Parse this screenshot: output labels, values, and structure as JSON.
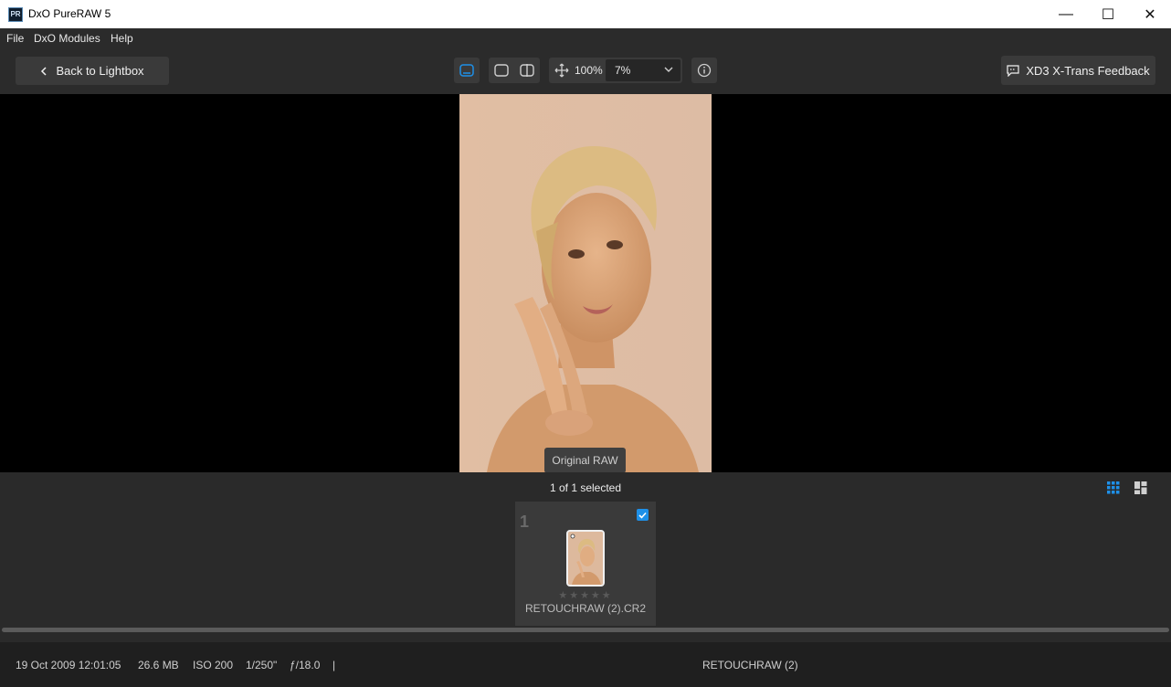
{
  "window": {
    "app_icon_text": "PR",
    "title": "DxO PureRAW 5",
    "minimize": "—",
    "maximize": "☐",
    "close": "✕"
  },
  "menu": [
    "File",
    "DxO Modules",
    "Help"
  ],
  "toolbar": {
    "back_label": "Back to Lightbox",
    "zoom_fit_label": "100%",
    "zoom_value": "7%",
    "feedback_label": "XD3 X-Trans Feedback",
    "icons": [
      "single-view-icon",
      "side-by-side-icon",
      "split-view-icon",
      "pan-icon",
      "info-icon"
    ],
    "accent_color": "#1e90e8"
  },
  "viewer": {
    "overlay_label": "Original RAW"
  },
  "filmstrip": {
    "selection_text": "1 of 1 selected",
    "items": [
      {
        "index": "1",
        "stars": "★★★★★",
        "rating": 0,
        "filename": "RETOUCHRAW (2).CR2",
        "selected": true
      }
    ]
  },
  "status": {
    "date": "19 Oct 2009 12:01:05",
    "size": "26.6 MB",
    "iso": "ISO 200",
    "shutter": "1/250\"",
    "aperture": "ƒ/18.0",
    "separator": "|",
    "name": "RETOUCHRAW (2)"
  }
}
